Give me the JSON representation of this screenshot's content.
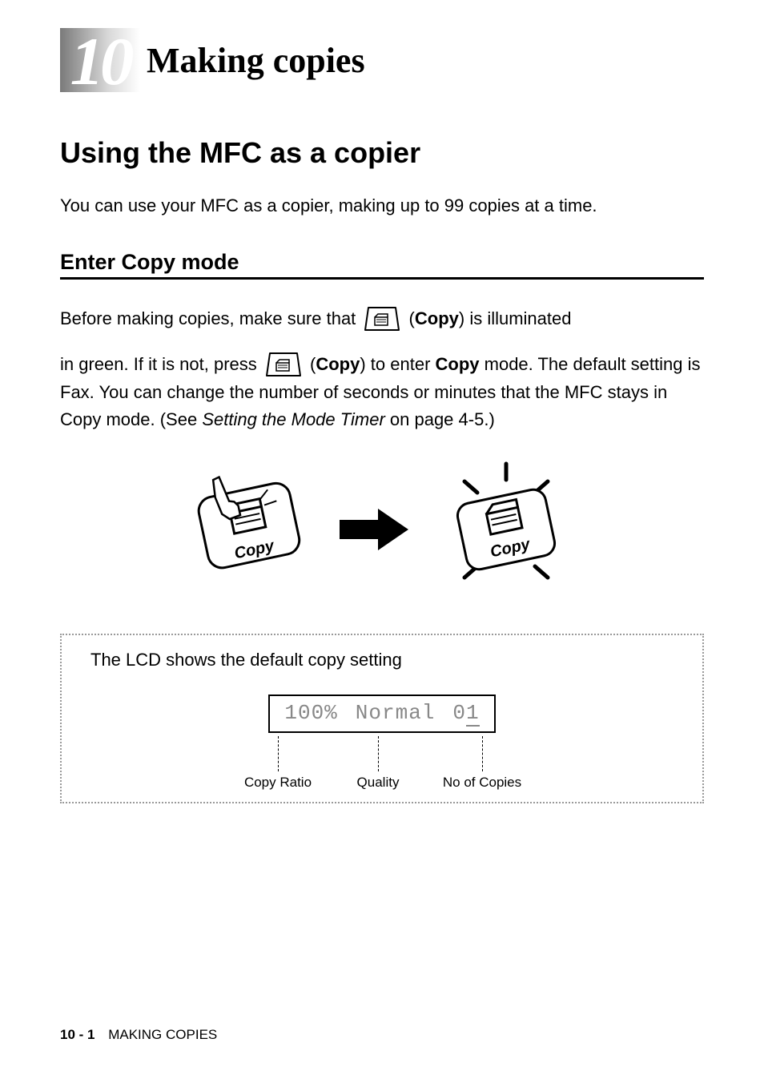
{
  "chapter": {
    "number": "10",
    "title": "Making copies"
  },
  "section_heading": "Using the MFC as a copier",
  "intro_text": "You can use your MFC as a copier, making up to 99 copies at a time.",
  "subsection_heading": "Enter Copy mode",
  "para1_before_key": "Before making copies, make sure that ",
  "para1_after_key_open": " (",
  "para1_copy_word": "Copy",
  "para1_close": ") is illuminated",
  "para2_before_key": "in green. If it is not, press ",
  "para2_after_key_open": " (",
  "para2_copy_word": "Copy",
  "para2_mid": ") to enter ",
  "para2_copy_word2": "Copy",
  "para2_end": " mode. The default setting is Fax. You can change the number of seconds or minutes that the MFC stays in Copy mode. (See ",
  "para2_ref_italic": "Setting the Mode Timer",
  "para2_ref_end": " on page 4-5.)",
  "illustration_left_label": "Copy",
  "illustration_right_label": "Copy",
  "dotted_heading": "The LCD shows the default copy setting",
  "lcd": {
    "ratio": "100%",
    "quality": "Normal",
    "copies_first": "0",
    "copies_last": "1"
  },
  "callouts": {
    "ratio": "Copy Ratio",
    "quality": "Quality",
    "copies": "No of Copies"
  },
  "footer": {
    "page_num": "10 - 1",
    "running": "MAKING COPIES"
  }
}
